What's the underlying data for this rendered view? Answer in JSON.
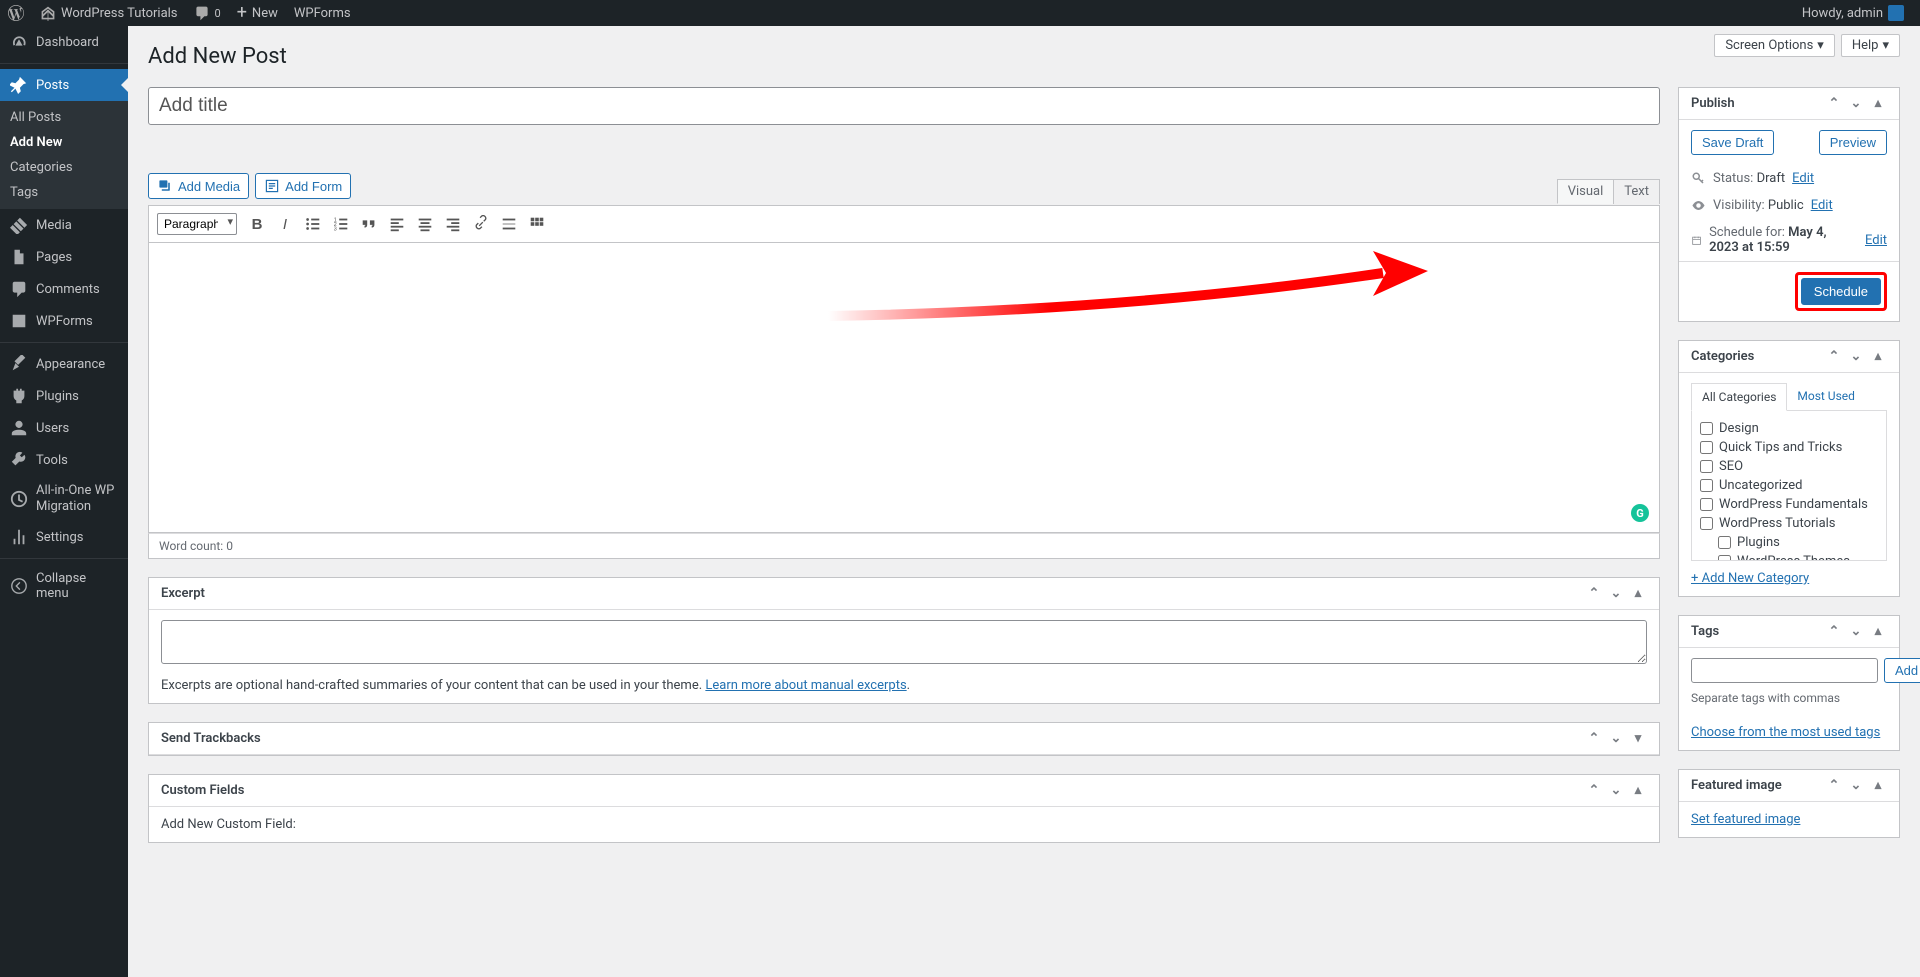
{
  "adminbar": {
    "site_title": "WordPress Tutorials",
    "comment_count": "0",
    "new_label": "New",
    "wpforms": "WPForms",
    "howdy": "Howdy, admin"
  },
  "sidebar": {
    "dashboard": "Dashboard",
    "posts": "Posts",
    "posts_sub": {
      "all": "All Posts",
      "addnew": "Add New",
      "categories": "Categories",
      "tags": "Tags"
    },
    "media": "Media",
    "pages": "Pages",
    "comments": "Comments",
    "wpforms": "WPForms",
    "appearance": "Appearance",
    "plugins": "Plugins",
    "users": "Users",
    "tools": "Tools",
    "migration": "All-in-One WP Migration",
    "settings": "Settings",
    "collapse": "Collapse menu"
  },
  "head": {
    "screen_options": "Screen Options",
    "help": "Help"
  },
  "page_title": "Add New Post",
  "title_placeholder": "Add title",
  "editor_btns": {
    "add_media": "Add Media",
    "add_form": "Add Form"
  },
  "tabs": {
    "visual": "Visual",
    "text": "Text"
  },
  "format_select": "Paragraph",
  "word_count_label": "Word count: ",
  "word_count_value": "0",
  "excerpt": {
    "title": "Excerpt",
    "help": "Excerpts are optional hand-crafted summaries of your content that can be used in your theme. ",
    "help_link": "Learn more about manual excerpts"
  },
  "trackbacks": {
    "title": "Send Trackbacks"
  },
  "custom_fields": {
    "title": "Custom Fields",
    "add_label": "Add New Custom Field:"
  },
  "publish": {
    "box_title": "Publish",
    "save_draft": "Save Draft",
    "preview": "Preview",
    "status_label": "Status:",
    "status_value": "Draft",
    "visibility_label": "Visibility:",
    "visibility_value": "Public",
    "schedule_label": "Schedule for:",
    "schedule_value": "May 4, 2023 at 15:59",
    "edit": "Edit",
    "schedule_btn": "Schedule"
  },
  "categories": {
    "box_title": "Categories",
    "tab_all": "All Categories",
    "tab_most": "Most Used",
    "items": [
      "Design",
      "Quick Tips and Tricks",
      "SEO",
      "Uncategorized",
      "WordPress Fundamentals",
      "WordPress Tutorials"
    ],
    "sub_items": [
      "Plugins",
      "WordPress Themes"
    ],
    "add_new": "+ Add New Category"
  },
  "tags": {
    "box_title": "Tags",
    "add": "Add",
    "help": "Separate tags with commas",
    "choose": "Choose from the most used tags"
  },
  "featured": {
    "box_title": "Featured image",
    "set": "Set featured image"
  }
}
